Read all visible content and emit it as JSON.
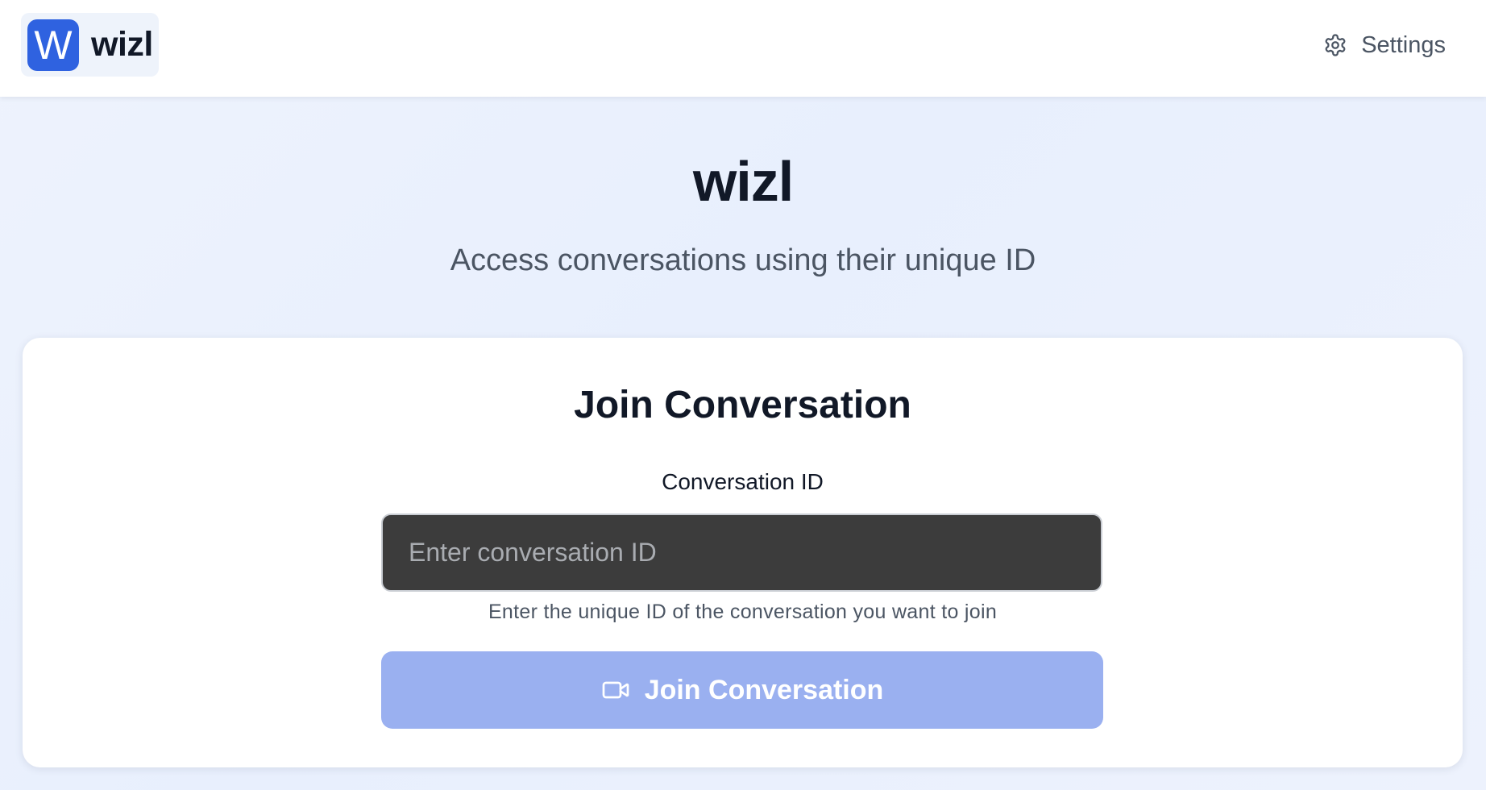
{
  "header": {
    "brand_mark": "W",
    "brand_name": "wizl",
    "settings_label": "Settings",
    "settings_icon": "gear-icon"
  },
  "hero": {
    "title": "wizl",
    "subtitle": "Access conversations using their unique ID"
  },
  "join_card": {
    "title": "Join Conversation",
    "field_label": "Conversation ID",
    "input_value": "",
    "input_placeholder": "Enter conversation ID",
    "help_text": "Enter the unique ID of the conversation you want to join",
    "button_label": "Join Conversation",
    "button_icon": "video-camera-icon"
  },
  "colors": {
    "brand_accent": "#2f62e0",
    "button_disabled": "#9ab0f0",
    "input_background": "#3c3c3c"
  }
}
